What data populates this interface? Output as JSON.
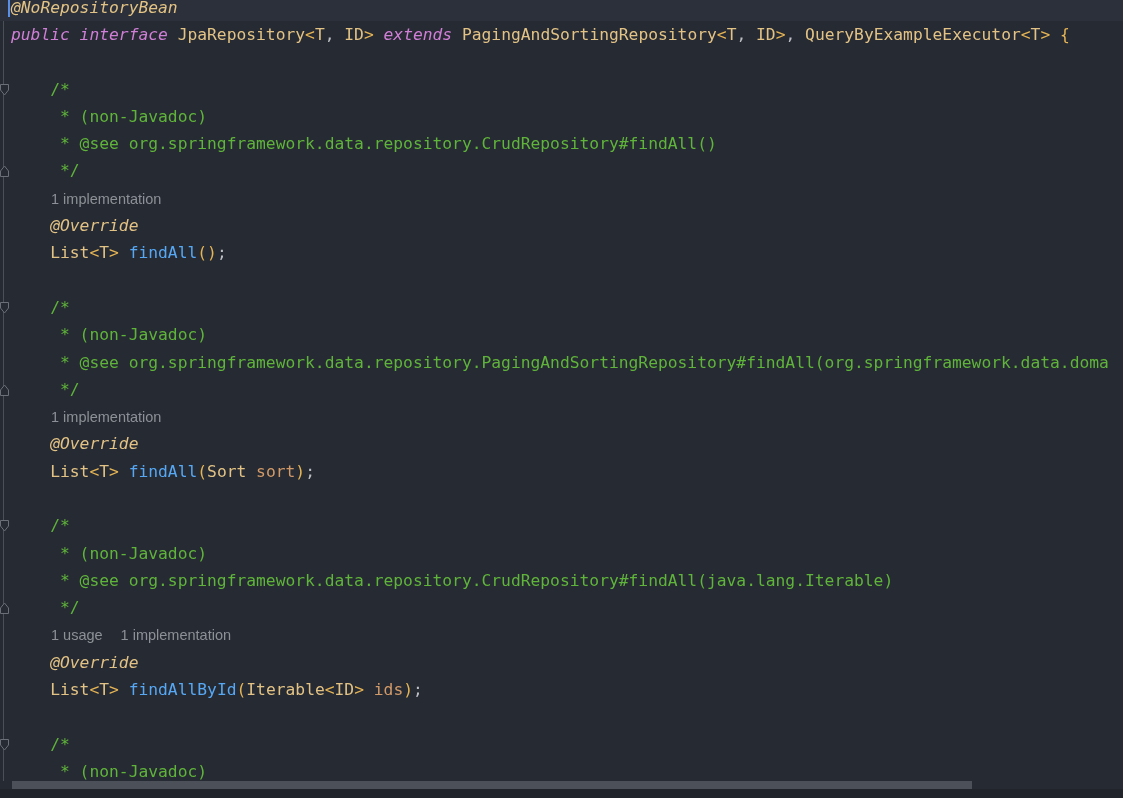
{
  "editor": {
    "lines": [
      {
        "kind": "code",
        "current": true,
        "tokens": [
          {
            "t": "@NoRepositoryBean",
            "color": "#e3c385",
            "italic": true
          }
        ]
      },
      {
        "kind": "code",
        "tokens": [
          {
            "t": "public interface",
            "color": "#cf7fd6",
            "italic": true
          },
          {
            "t": " JpaRepository",
            "color": "#e3c385"
          },
          {
            "t": "<",
            "color": "#e5b454"
          },
          {
            "t": "T",
            "color": "#e3c385"
          },
          {
            "t": ", ",
            "color": "#bcbec4"
          },
          {
            "t": "ID",
            "color": "#e3c385"
          },
          {
            "t": ">",
            "color": "#e5b454"
          },
          {
            "t": " extends",
            "color": "#cf7fd6",
            "italic": true
          },
          {
            "t": " PagingAndSortingRepository",
            "color": "#e3c385"
          },
          {
            "t": "<",
            "color": "#e5b454"
          },
          {
            "t": "T",
            "color": "#e3c385"
          },
          {
            "t": ", ",
            "color": "#bcbec4"
          },
          {
            "t": "ID",
            "color": "#e3c385"
          },
          {
            "t": ">",
            "color": "#e5b454"
          },
          {
            "t": ", ",
            "color": "#bcbec4"
          },
          {
            "t": "QueryByExampleExecutor",
            "color": "#e3c385"
          },
          {
            "t": "<",
            "color": "#e5b454"
          },
          {
            "t": "T",
            "color": "#e3c385"
          },
          {
            "t": "> {",
            "color": "#e5b454"
          }
        ]
      },
      {
        "kind": "blank"
      },
      {
        "kind": "foldstart",
        "tokens": [
          {
            "t": "    /*",
            "color": "#5fb43a"
          }
        ]
      },
      {
        "kind": "code",
        "tokens": [
          {
            "t": "     * (non-Javadoc)",
            "color": "#5fb43a"
          }
        ]
      },
      {
        "kind": "code",
        "tokens": [
          {
            "t": "     * @see org.springframework.data.repository.CrudRepository#findAll()",
            "color": "#5fb43a"
          }
        ]
      },
      {
        "kind": "foldend",
        "tokens": [
          {
            "t": "     */",
            "color": "#5fb43a"
          }
        ]
      },
      {
        "kind": "hint",
        "hints": [
          "1 implementation"
        ]
      },
      {
        "kind": "code",
        "tokens": [
          {
            "t": "    @Override",
            "color": "#e3c385",
            "italic": true
          }
        ]
      },
      {
        "kind": "code",
        "tokens": [
          {
            "t": "    List",
            "color": "#e3c385"
          },
          {
            "t": "<",
            "color": "#e5b454"
          },
          {
            "t": "T",
            "color": "#e3c385"
          },
          {
            "t": ">",
            "color": "#e5b454"
          },
          {
            "t": " findAll",
            "color": "#56a8f5"
          },
          {
            "t": "()",
            "color": "#e5b454"
          },
          {
            "t": ";",
            "color": "#bcbec4"
          }
        ]
      },
      {
        "kind": "blank"
      },
      {
        "kind": "foldstart",
        "tokens": [
          {
            "t": "    /*",
            "color": "#5fb43a"
          }
        ]
      },
      {
        "kind": "code",
        "tokens": [
          {
            "t": "     * (non-Javadoc)",
            "color": "#5fb43a"
          }
        ]
      },
      {
        "kind": "code",
        "tokens": [
          {
            "t": "     * @see org.springframework.data.repository.PagingAndSortingRepository#findAll(org.springframework.data.doma",
            "color": "#5fb43a"
          }
        ]
      },
      {
        "kind": "foldend",
        "tokens": [
          {
            "t": "     */",
            "color": "#5fb43a"
          }
        ]
      },
      {
        "kind": "hint",
        "hints": [
          "1 implementation"
        ]
      },
      {
        "kind": "code",
        "tokens": [
          {
            "t": "    @Override",
            "color": "#e3c385",
            "italic": true
          }
        ]
      },
      {
        "kind": "code",
        "tokens": [
          {
            "t": "    List",
            "color": "#e3c385"
          },
          {
            "t": "<",
            "color": "#e5b454"
          },
          {
            "t": "T",
            "color": "#e3c385"
          },
          {
            "t": ">",
            "color": "#e5b454"
          },
          {
            "t": " findAll",
            "color": "#56a8f5"
          },
          {
            "t": "(",
            "color": "#e5b454"
          },
          {
            "t": "Sort",
            "color": "#e3c385"
          },
          {
            "t": " sort",
            "color": "#d29a68"
          },
          {
            "t": ")",
            "color": "#e5b454"
          },
          {
            "t": ";",
            "color": "#bcbec4"
          }
        ]
      },
      {
        "kind": "blank"
      },
      {
        "kind": "foldstart",
        "tokens": [
          {
            "t": "    /*",
            "color": "#5fb43a"
          }
        ]
      },
      {
        "kind": "code",
        "tokens": [
          {
            "t": "     * (non-Javadoc)",
            "color": "#5fb43a"
          }
        ]
      },
      {
        "kind": "code",
        "tokens": [
          {
            "t": "     * @see org.springframework.data.repository.CrudRepository#findAll(java.lang.Iterable)",
            "color": "#5fb43a"
          }
        ]
      },
      {
        "kind": "foldend",
        "tokens": [
          {
            "t": "     */",
            "color": "#5fb43a"
          }
        ]
      },
      {
        "kind": "hint",
        "hints": [
          "1 usage",
          "1 implementation"
        ]
      },
      {
        "kind": "code",
        "tokens": [
          {
            "t": "    @Override",
            "color": "#e3c385",
            "italic": true
          }
        ]
      },
      {
        "kind": "code",
        "tokens": [
          {
            "t": "    List",
            "color": "#e3c385"
          },
          {
            "t": "<",
            "color": "#e5b454"
          },
          {
            "t": "T",
            "color": "#e3c385"
          },
          {
            "t": ">",
            "color": "#e5b454"
          },
          {
            "t": " findAllById",
            "color": "#56a8f5"
          },
          {
            "t": "(",
            "color": "#e5b454"
          },
          {
            "t": "Iterable",
            "color": "#e3c385"
          },
          {
            "t": "<",
            "color": "#e5b454"
          },
          {
            "t": "ID",
            "color": "#e3c385"
          },
          {
            "t": ">",
            "color": "#e5b454"
          },
          {
            "t": " ids",
            "color": "#d29a68"
          },
          {
            "t": ")",
            "color": "#e5b454"
          },
          {
            "t": ";",
            "color": "#bcbec4"
          }
        ]
      },
      {
        "kind": "blank"
      },
      {
        "kind": "foldstart",
        "tokens": [
          {
            "t": "    /*",
            "color": "#5fb43a"
          }
        ]
      },
      {
        "kind": "code",
        "tokens": [
          {
            "t": "     * (non-Javadoc)",
            "color": "#5fb43a"
          }
        ]
      }
    ]
  }
}
